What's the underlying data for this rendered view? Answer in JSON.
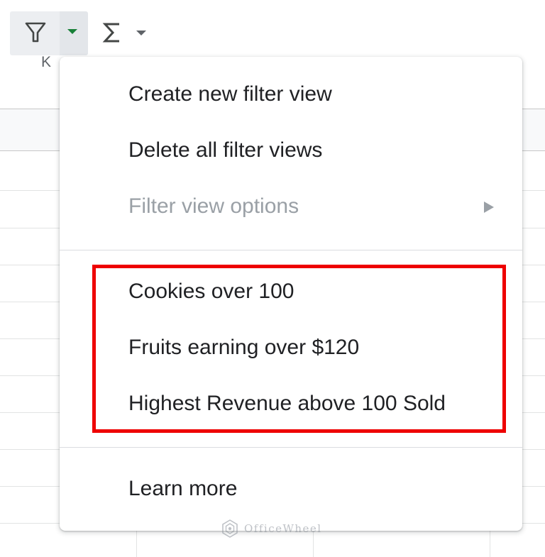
{
  "toolbar": {
    "filter_icon": "filter-funnel-icon",
    "dropdown_icon": "caret-down-icon",
    "functions_icon": "sigma-icon",
    "accent_color": "#188038"
  },
  "sheet": {
    "column_header": "K"
  },
  "menu": {
    "items": [
      {
        "label": "Create new filter view",
        "enabled": true
      },
      {
        "label": "Delete all filter views",
        "enabled": true
      },
      {
        "label": "Filter view options",
        "enabled": false,
        "has_submenu": true
      }
    ],
    "saved_views": [
      {
        "label": "Cookies over 100"
      },
      {
        "label": "Fruits earning over $120"
      },
      {
        "label": "Highest Revenue above 100 Sold"
      }
    ],
    "footer": {
      "label": "Learn more"
    },
    "highlight_color": "#ee0000",
    "disabled_color": "#9aa0a6"
  },
  "watermark": {
    "text": "OfficeWheel"
  }
}
